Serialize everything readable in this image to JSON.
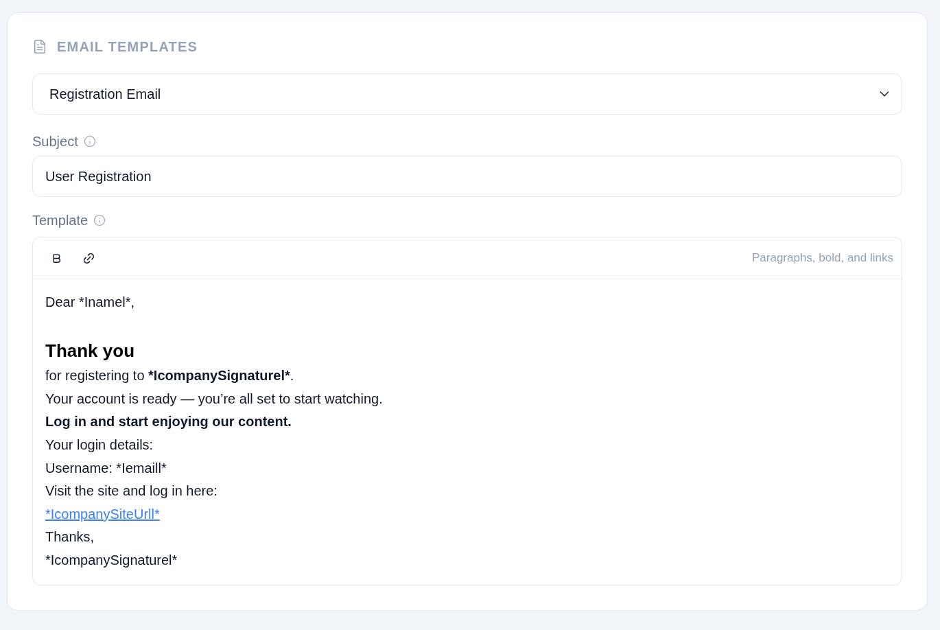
{
  "section": {
    "title": "EMAIL TEMPLATES"
  },
  "template_select": {
    "value": "Registration Email"
  },
  "subject": {
    "label": "Subject",
    "value": "User Registration"
  },
  "template": {
    "label": "Template",
    "toolbar": {
      "tools": [
        {
          "kind": "bold"
        },
        {
          "kind": "link"
        }
      ],
      "hint": "Paragraphs, bold, and links"
    },
    "body": [
      {
        "kind": "paragraph",
        "segments": [
          {
            "text": "Dear *Inamel*,",
            "bold": false
          }
        ]
      },
      {
        "kind": "blank"
      },
      {
        "kind": "heading",
        "text": "Thank you"
      },
      {
        "kind": "paragraph",
        "segments": [
          {
            "text": "for registering to ",
            "bold": false
          },
          {
            "text": "*IcompanySignaturel*",
            "bold": true
          },
          {
            "text": ".",
            "bold": false
          }
        ]
      },
      {
        "kind": "paragraph",
        "segments": [
          {
            "text": "Your account is ready — you’re all set to start watching.",
            "bold": false
          }
        ]
      },
      {
        "kind": "paragraph",
        "segments": [
          {
            "text": "Log in and start enjoying our content.",
            "bold": true
          }
        ]
      },
      {
        "kind": "paragraph",
        "segments": [
          {
            "text": "Your login details:",
            "bold": false
          }
        ]
      },
      {
        "kind": "paragraph",
        "segments": [
          {
            "text": "Username: *Iemaill*",
            "bold": false
          }
        ]
      },
      {
        "kind": "paragraph",
        "segments": [
          {
            "text": "Visit the site and log in here:",
            "bold": false
          }
        ]
      },
      {
        "kind": "link",
        "text": "*IcompanySiteUrll*"
      },
      {
        "kind": "paragraph",
        "segments": [
          {
            "text": "Thanks,",
            "bold": false
          }
        ]
      },
      {
        "kind": "paragraph",
        "segments": [
          {
            "text": "*IcompanySignaturel*",
            "bold": false
          }
        ]
      }
    ]
  }
}
